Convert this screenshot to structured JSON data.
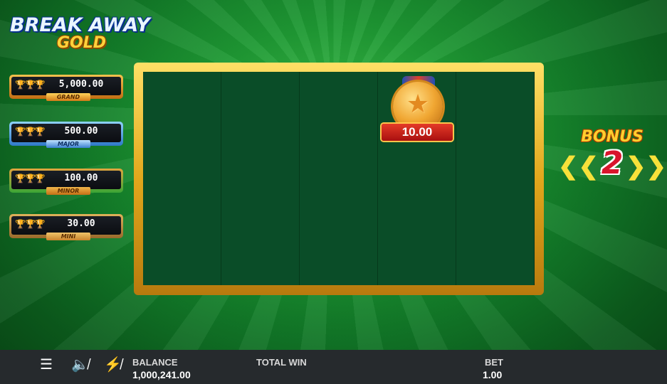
{
  "logo": {
    "line1": "BREAK AWAY",
    "line2": "GOLD"
  },
  "jackpots": [
    {
      "icon": "trophy-icons",
      "value": "5,000.00",
      "label": "GRAND"
    },
    {
      "icon": "trophy-icons",
      "value": "500.00",
      "label": "MAJOR"
    },
    {
      "icon": "trophy-icons",
      "value": "100.00",
      "label": "MINOR"
    },
    {
      "icon": "trophy-icons",
      "value": "30.00",
      "label": "MINI"
    }
  ],
  "reels": {
    "medal_value": "10.00"
  },
  "bonus": {
    "label": "BONUS",
    "count": "2"
  },
  "footer": {
    "menu_icon": "menu-icon",
    "sound_icon": "mute-icon",
    "turbo_icon": "turbo-off-icon",
    "balance_label": "BALANCE",
    "balance_value": "1,000,241.00",
    "total_win_label": "TOTAL WIN",
    "bet_label": "BET",
    "bet_value": "1.00"
  }
}
